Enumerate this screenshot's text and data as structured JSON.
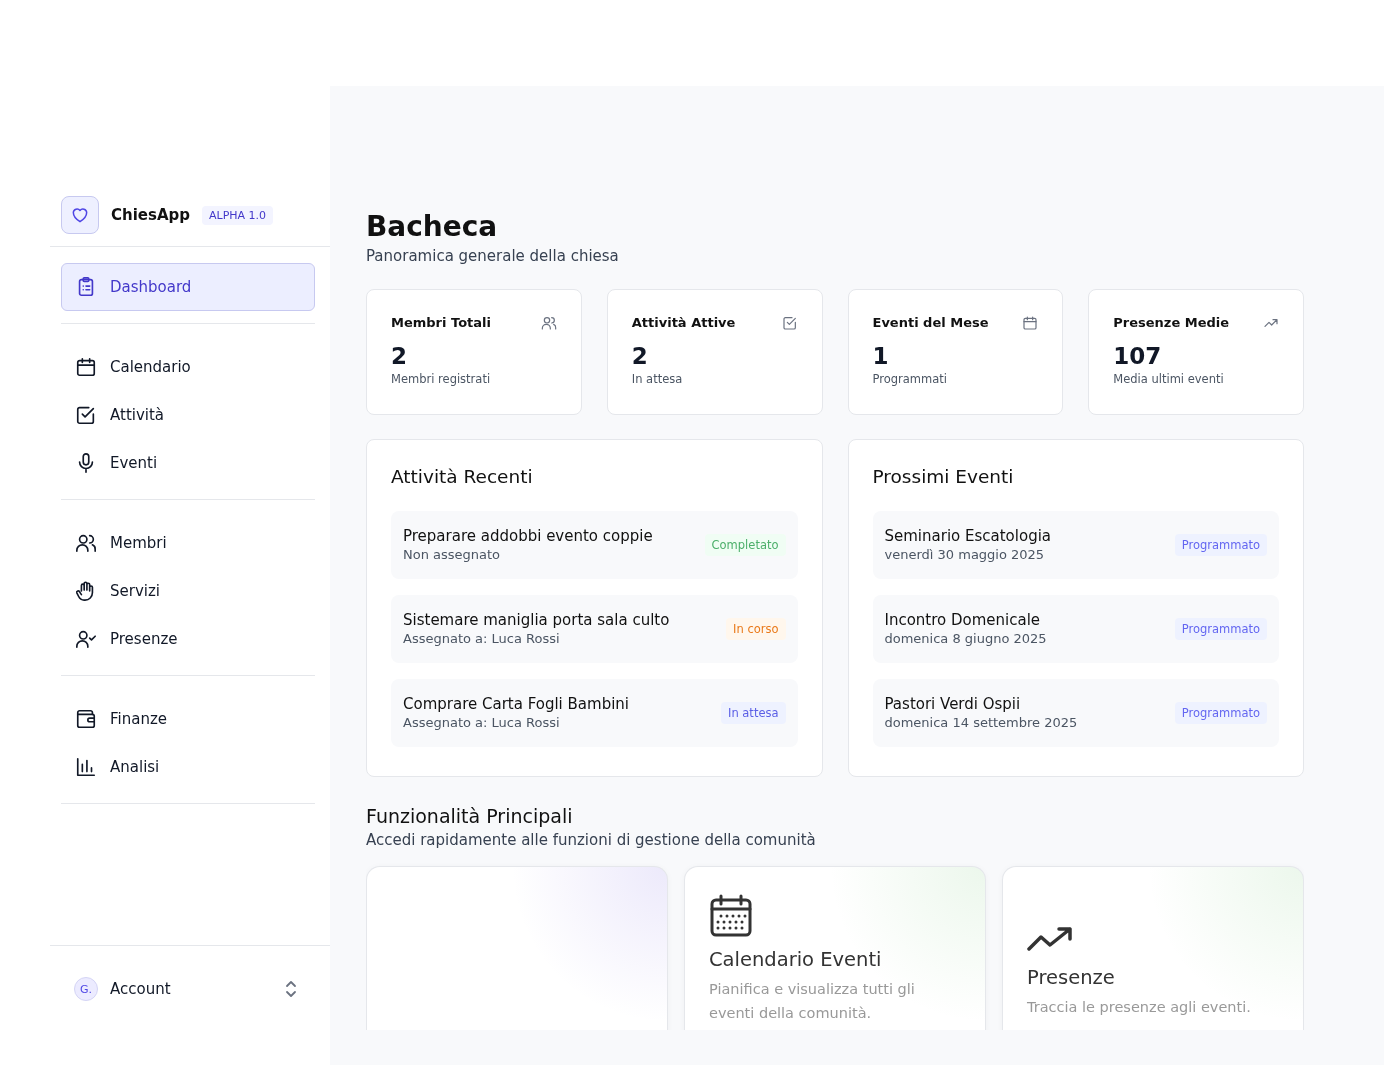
{
  "brand": {
    "name": "ChiesApp",
    "badge": "ALPHA 1.0"
  },
  "nav_groups": [
    {
      "items": [
        {
          "label": "Dashboard",
          "kind": "clipboard",
          "selected": true
        }
      ]
    },
    {
      "items": [
        {
          "label": "Calendario",
          "kind": "calendar",
          "selected": false
        },
        {
          "label": "Attività",
          "kind": "check",
          "selected": false
        },
        {
          "label": "Eventi",
          "kind": "mic",
          "selected": false
        }
      ]
    },
    {
      "items": [
        {
          "label": "Membri",
          "kind": "users",
          "selected": false
        },
        {
          "label": "Servizi",
          "kind": "hand",
          "selected": false
        },
        {
          "label": "Presenze",
          "kind": "usercheck",
          "selected": false
        }
      ]
    },
    {
      "items": [
        {
          "label": "Finanze",
          "kind": "wallet",
          "selected": false
        },
        {
          "label": "Analisi",
          "kind": "chart",
          "selected": false
        }
      ]
    }
  ],
  "account": {
    "initial": "G.",
    "label": "Account"
  },
  "header": {
    "title": "Bacheca",
    "subtitle": "Panoramica generale della chiesa"
  },
  "stats": [
    {
      "label": "Membri Totali",
      "kind": "users",
      "value": "2",
      "note": "Membri registrati"
    },
    {
      "label": "Attività Attive",
      "kind": "check",
      "value": "2",
      "note": "In attesa"
    },
    {
      "label": "Eventi del Mese",
      "kind": "calendar",
      "value": "1",
      "note": "Programmati"
    },
    {
      "label": "Presenze Medie",
      "kind": "trend",
      "value": "107",
      "note": "Media ultimi eventi"
    }
  ],
  "recent_activities": {
    "title": "Attività Recenti",
    "items": [
      {
        "title": "Preparare addobbi evento coppie",
        "subtitle": "Non assegnato",
        "status": "Completato",
        "kind": "completed"
      },
      {
        "title": "Sistemare maniglia porta sala culto",
        "subtitle": "Assegnato a: Luca Rossi",
        "status": "In corso",
        "kind": "in_progress"
      },
      {
        "title": "Comprare Carta Fogli Bambini",
        "subtitle": "Assegnato a: Luca Rossi",
        "status": "In attesa",
        "kind": "pending"
      }
    ]
  },
  "upcoming_events": {
    "title": "Prossimi Eventi",
    "items": [
      {
        "title": "Seminario Escatologia",
        "subtitle": "venerdì 30 maggio 2025",
        "status": "Programmato",
        "kind": "scheduled"
      },
      {
        "title": "Incontro Domenicale",
        "subtitle": "domenica 8 giugno 2025",
        "status": "Programmato",
        "kind": "scheduled"
      },
      {
        "title": "Pastori Verdi Ospii",
        "subtitle": "domenica 14 settembre 2025",
        "status": "Programmato",
        "kind": "scheduled"
      }
    ]
  },
  "features": {
    "title": "Funzionalità Principali",
    "subtitle": "Accedi rapidamente alle funzioni di gestione della comunità",
    "cards": [
      {
        "kind": "blank"
      },
      {
        "kind": "calendar",
        "title": "Calendario Eventi",
        "description": "Pianifica e visualizza tutti gli eventi della comunità."
      },
      {
        "kind": "trend",
        "title": "Presenze",
        "description": "Traccia le presenze agli eventi."
      }
    ]
  }
}
